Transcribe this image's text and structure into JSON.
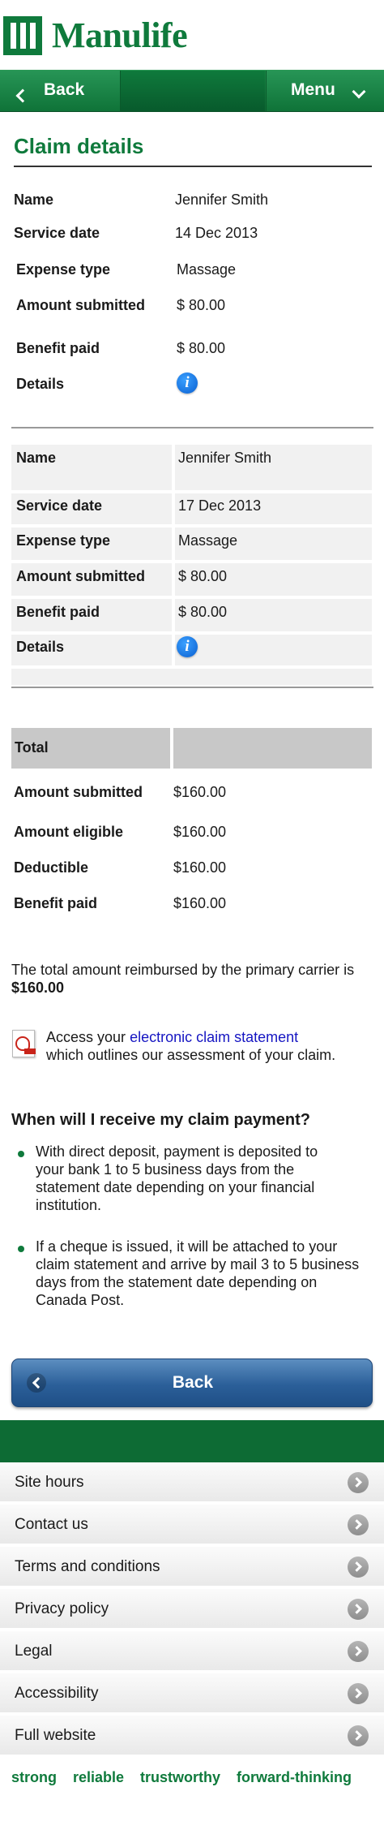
{
  "brand": {
    "name": "Manulife"
  },
  "nav": {
    "back_label": "Back",
    "menu_label": "Menu"
  },
  "page": {
    "title": "Claim details"
  },
  "claims": [
    {
      "rows": [
        {
          "label": "Name",
          "value": "Jennifer Smith"
        },
        {
          "label": "Service date",
          "value": "14 Dec 2013"
        },
        {
          "label": "Expense type",
          "value": "Massage"
        },
        {
          "label": "Amount submitted",
          "value": "$ 80.00"
        },
        {
          "label": "Benefit paid",
          "value": "$ 80.00"
        }
      ],
      "details_label": "Details",
      "details_icon": "info-icon"
    },
    {
      "rows": [
        {
          "label": "Name",
          "value": "Jennifer Smith"
        },
        {
          "label": "Service date",
          "value": "17 Dec 2013"
        },
        {
          "label": "Expense type",
          "value": "Massage"
        },
        {
          "label": "Amount submitted",
          "value": "$ 80.00"
        },
        {
          "label": "Benefit paid",
          "value": "$ 80.00"
        }
      ],
      "details_label": "Details",
      "details_icon": "info-icon"
    }
  ],
  "totals": {
    "header": "Total",
    "rows": [
      {
        "label": "Amount submitted",
        "value": "$160.00"
      },
      {
        "label": "Amount eligible",
        "value": "$160.00"
      },
      {
        "label": "Deductible",
        "value": "$160.00"
      },
      {
        "label": "Benefit paid",
        "value": "$160.00"
      }
    ]
  },
  "reimbursed": {
    "text": "The total amount reimbursed by the primary carrier is",
    "amount": "$160.00"
  },
  "statement": {
    "prefix": "Access your",
    "link": "electronic claim statement",
    "suffix": "which outlines our assessment of your claim."
  },
  "faq": {
    "question": "When will I receive my claim payment?",
    "bullets": [
      "With direct deposit, payment is deposited to your bank 1 to 5 business days from the statement date depending on your financial institution.",
      "If a cheque is issued, it will be attached to your claim statement and arrive by mail 3 to 5 business days from the statement date depending on Canada Post."
    ]
  },
  "back_button": {
    "label": "Back"
  },
  "footer": {
    "items": [
      "Site hours",
      "Contact us",
      "Terms and conditions",
      "Privacy policy",
      "Legal",
      "Accessibility",
      "Full website"
    ],
    "taglines": [
      "strong",
      "reliable",
      "trustworthy",
      "forward-thinking"
    ]
  },
  "colors": {
    "brand_green": "#0f7a3c",
    "link_blue": "#1515c2",
    "button_blue": "#2b5f99"
  }
}
